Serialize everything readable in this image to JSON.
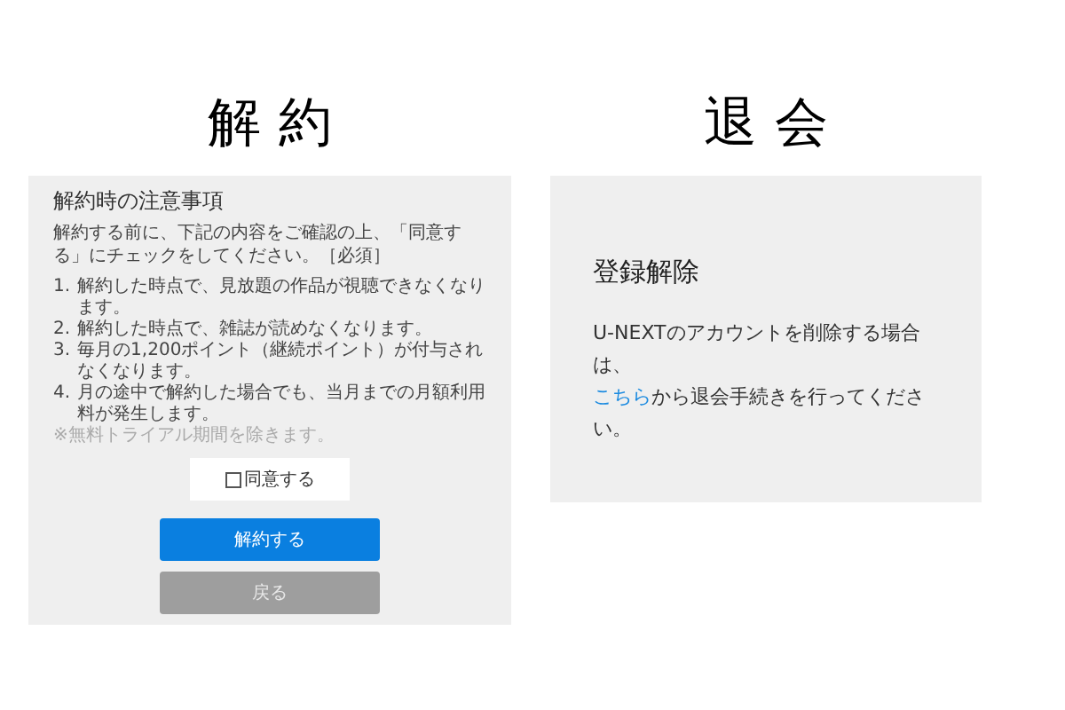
{
  "left": {
    "heading": "解 約",
    "title": "解約時の注意事項",
    "intro": "解約する前に、下記の内容をご確認の上、「同意する」にチェックをしてください。［必須］",
    "items": [
      {
        "number": "1.",
        "text": "解約した時点で、見放題の作品が視聴できなくなります。"
      },
      {
        "number": "2.",
        "text": "解約した時点で、雑誌が読めなくなります。"
      },
      {
        "number": "3.",
        "text": "毎月の1,200ポイント（継続ポイント）が付与されなくなります。"
      },
      {
        "number": "4.",
        "text": "月の途中で解約した場合でも、当月までの月額利用料が発生します。"
      }
    ],
    "note": "※無料トライアル期間を除きます。",
    "agree": {
      "label": "同意する",
      "checked": false
    },
    "buttons": [
      {
        "label": "解約する",
        "kind": "primary"
      },
      {
        "label": "戻る",
        "kind": "secondary"
      }
    ]
  },
  "right": {
    "heading": "退 会",
    "title": "登録解除",
    "line1": "U-NEXTのアカウントを削除する場合は、",
    "link": "こちら",
    "line2": "から退会手続きを行ってください。"
  }
}
